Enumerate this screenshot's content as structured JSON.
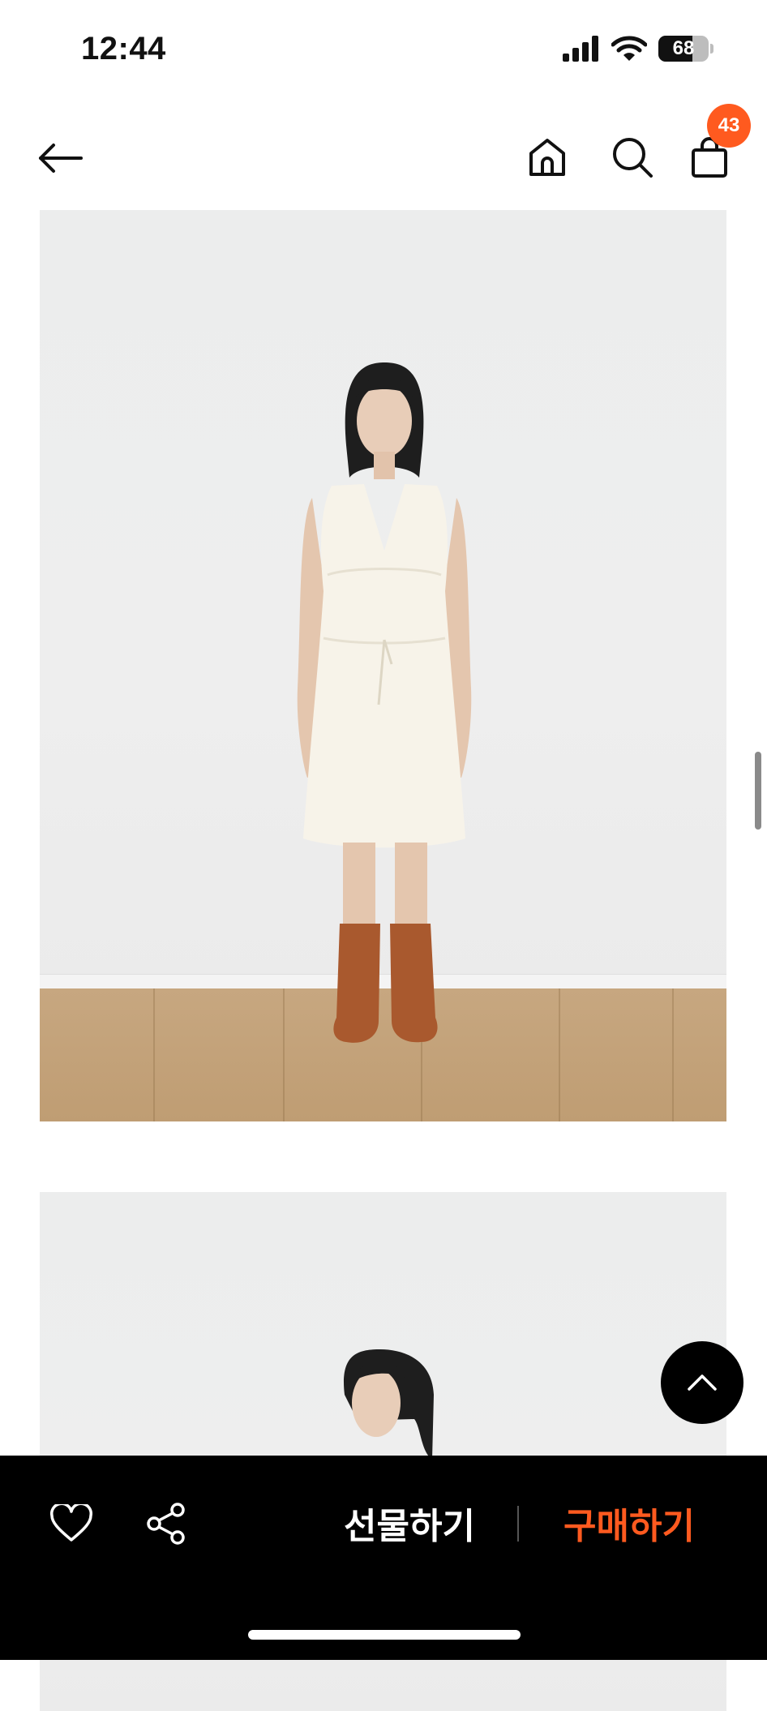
{
  "status_bar": {
    "time": "12:44",
    "battery": "68",
    "battery_level_percent": 68,
    "icons": [
      "signal-icon",
      "wifi-icon",
      "battery-icon"
    ]
  },
  "header": {
    "cart_badge": "43",
    "icons": [
      "back-arrow-icon",
      "home-icon",
      "search-icon",
      "shopping-bag-icon"
    ]
  },
  "bottom_bar": {
    "gift_label": "선물하기",
    "buy_label": "구매하기",
    "icons": [
      "heart-icon",
      "share-icon"
    ]
  },
  "floating": {
    "icon": "chevron-up-icon"
  },
  "colors": {
    "accent": "#ff5a1f",
    "bottom_bar_bg": "#000000",
    "background": "#ffffff"
  }
}
